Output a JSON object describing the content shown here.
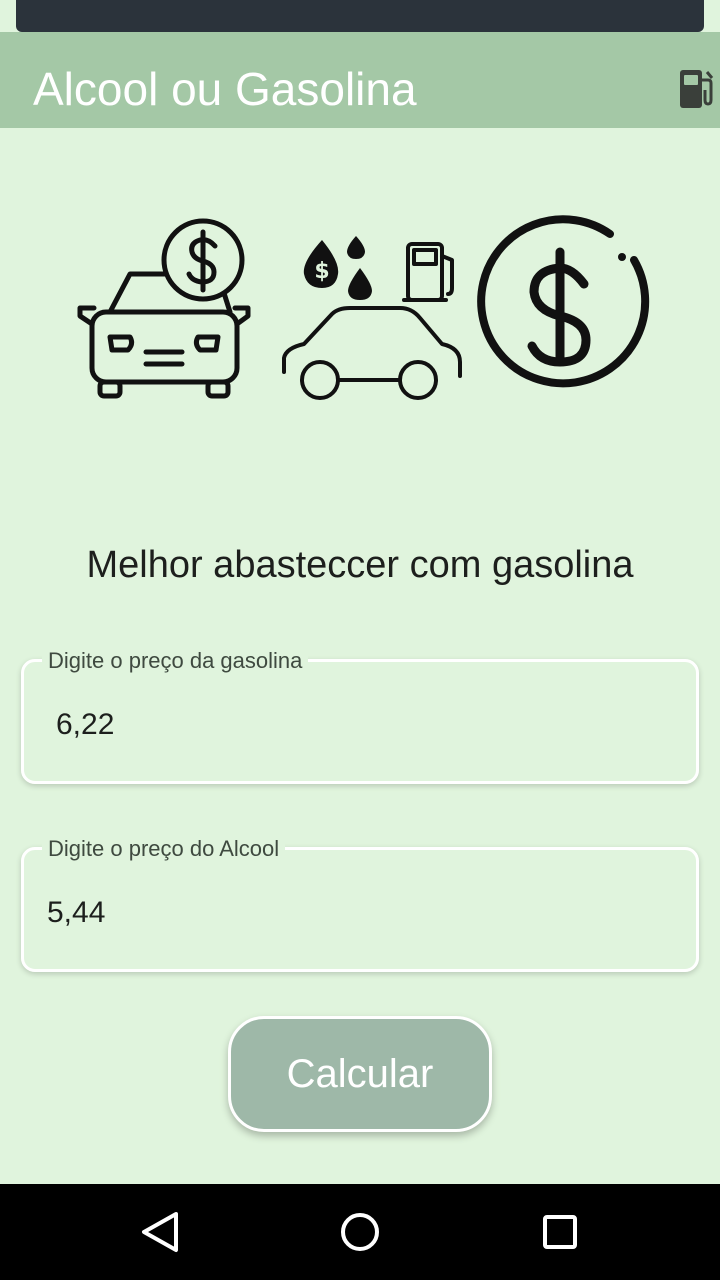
{
  "appbar": {
    "title": "Alcool ou Gasolina",
    "fuel_icon": "fuel-pump-icon",
    "color": "#a4c8a6"
  },
  "illustration": {
    "icons": [
      "car-dollar-icon",
      "car-fuel-drops-icon",
      "dollar-circle-icon"
    ]
  },
  "result_text": "Melhor abasteccer com gasolina",
  "form": {
    "gasoline": {
      "label": "Digite o preço da gasolina",
      "value": "6,22"
    },
    "alcohol": {
      "label": "Digite o preço do Alcool",
      "value": "5,44"
    }
  },
  "calculate_button": {
    "label": "Calcular",
    "color": "#9eb8a8"
  },
  "navbar": {
    "icons": [
      "back-icon",
      "home-icon",
      "recents-icon"
    ]
  },
  "colors": {
    "background": "#e0f4dd"
  }
}
